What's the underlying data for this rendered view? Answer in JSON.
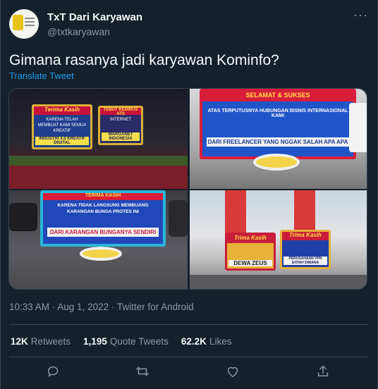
{
  "author": {
    "name": "TxT Dari Karyawan",
    "handle": "@txtkaryawan"
  },
  "tweet": {
    "text": "Gimana rasanya jadi karyawan Kominfo?",
    "translate_label": "Translate Tweet",
    "meta": "10:33 AM · Aug 1, 2022 · Twitter for Android"
  },
  "stats": {
    "retweets_count": "12K",
    "retweets_label": "Retweets",
    "quotes_count": "1,195",
    "quotes_label": "Quote Tweets",
    "likes_count": "62.2K",
    "likes_label": "Likes"
  },
  "photos": {
    "p1": {
      "board_left_title": "Terima Kasih",
      "board_left_text": "KARENA TELAH MEMBUAT KAMI SEMUA KREATIF",
      "board_left_footer": "INDUSTRI 4.0 KREATIF DIGITAL",
      "board_right_title": "TEBUT KEDIRUS ATS",
      "board_right_text": "INTERNET",
      "board_right_footer": "WARGANET INDONESIA"
    },
    "p2": {
      "header": "SELAMAT & SUKSES",
      "line1": "ATAS TERPUTUSNYA HUBUNGAN BISNIS INTERNASIONAL KAMI",
      "footer": "DARI FREELANCER YANG NGGAK SALAH APA APA"
    },
    "p3": {
      "header": "TERIMA KASIH",
      "line1": "KARENA TIDAK LANGSUNG MEMBUANG",
      "line2": "KARANGAN BUNGA PROTES INI",
      "footer": "DARI KARANGAN BUNGANYA SENDIRI"
    },
    "p4": {
      "left_title": "Trima Kasih",
      "left_footer": "DEWA ZEUS",
      "right_title": "Trima Kasih",
      "right_footer": "PERUSAHAAN VPN ENTAH DIMANA"
    }
  }
}
